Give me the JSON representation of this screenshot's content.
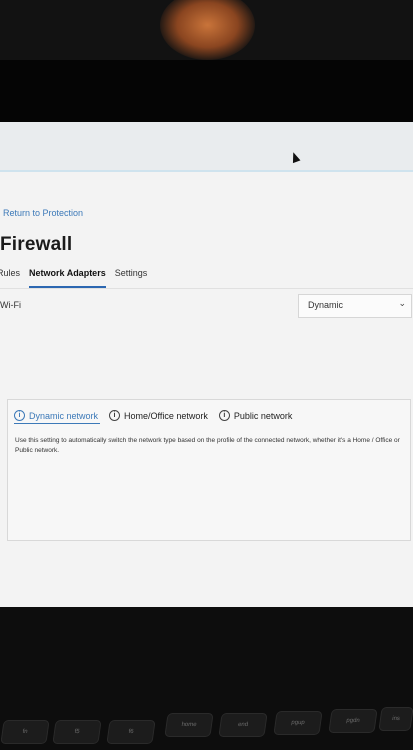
{
  "nav": {
    "back_label": "Return to Protection"
  },
  "page": {
    "title": "Firewall"
  },
  "tabs": [
    {
      "label": "Rules",
      "active": false
    },
    {
      "label": "Network Adapters",
      "active": true
    },
    {
      "label": "Settings",
      "active": false
    }
  ],
  "adapter": {
    "name": "Wi-Fi",
    "network_type": "Dynamic"
  },
  "network_options": [
    {
      "label": "Dynamic network",
      "selected": true,
      "icon": "info-icon"
    },
    {
      "label": "Home/Office network",
      "selected": false,
      "icon": "info-icon"
    },
    {
      "label": "Public network",
      "selected": false,
      "icon": "info-icon"
    }
  ],
  "description": "Use this setting to automatically switch the network type based on the profile of the connected network, whether it's a Home / Office or Public network.",
  "keyboard": {
    "keys": [
      "fn",
      "f5",
      "f6",
      "home",
      "end",
      "pgup",
      "pgdn",
      "ins"
    ]
  },
  "colors": {
    "accent": "#3c79b8",
    "tab_underline": "#2b67b1",
    "background": "#f3f3f3"
  }
}
